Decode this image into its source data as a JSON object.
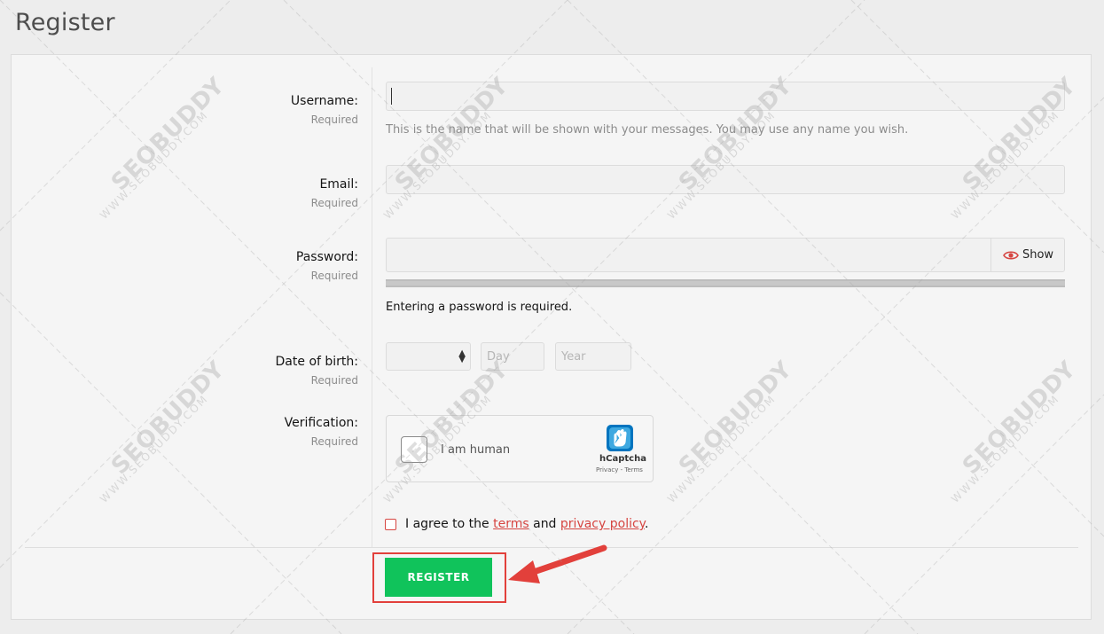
{
  "page": {
    "title": "Register"
  },
  "form": {
    "username": {
      "label": "Username:",
      "required": "Required",
      "value": "",
      "hint": "This is the name that will be shown with your messages. You may use any name you wish."
    },
    "email": {
      "label": "Email:",
      "required": "Required",
      "value": ""
    },
    "password": {
      "label": "Password:",
      "required": "Required",
      "value": "",
      "show_label": "Show",
      "message": "Entering a password is required."
    },
    "dob": {
      "label": "Date of birth:",
      "required": "Required",
      "month_value": "",
      "day_placeholder": "Day",
      "year_placeholder": "Year"
    },
    "verification": {
      "label": "Verification:",
      "required": "Required",
      "captcha_text": "I am human",
      "captcha_brand": "hCaptcha",
      "captcha_links": "Privacy - Terms"
    },
    "agree": {
      "prefix": "I agree to the",
      "terms": "terms",
      "and": "and",
      "privacy": "privacy policy",
      "suffix": "."
    },
    "register_label": "REGISTER"
  },
  "watermark": {
    "brand": "SEOBUDDY",
    "site": "WWW.SEOBUDDY.COM"
  },
  "colors": {
    "accent_red": "#d64541",
    "register_green": "#10c35b",
    "hcaptcha_blue": "#0074bf"
  }
}
